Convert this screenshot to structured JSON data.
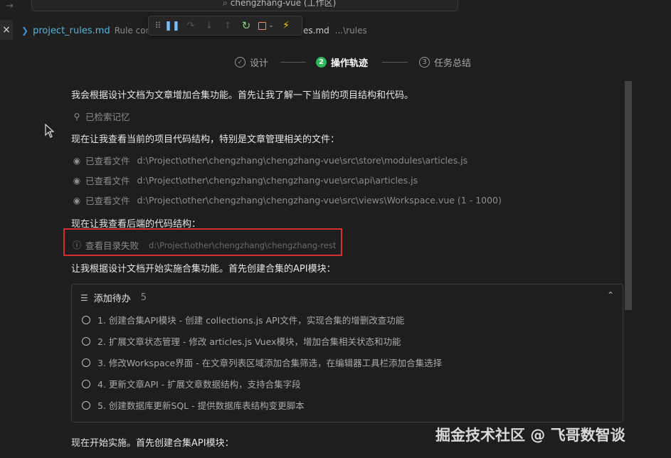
{
  "titlebar": {
    "forward_glyph": "→",
    "search_glyph": "⌕",
    "search_text": "chengzhang-vue (工作区)"
  },
  "tabs": {
    "close_glyph": "×",
    "active": {
      "icon": "❯",
      "name": "project_rules.md",
      "desc": "Rule confi"
    },
    "second": {
      "name": "es.md",
      "path": "...\\rules"
    }
  },
  "debug_toolbar": {
    "grip": "⠿",
    "pause": "❚❚",
    "step_over": "↷",
    "step_into": "↓",
    "step_out": "↑",
    "restart": "↻",
    "dropdown": "⌄",
    "bolt": "⚡"
  },
  "stepper": {
    "steps": [
      {
        "marker": "✓",
        "label": "设计"
      },
      {
        "marker": "2",
        "label": "操作轨迹"
      },
      {
        "marker": "3",
        "label": "任务总结"
      }
    ]
  },
  "messages": {
    "m1": "我会根据设计文档为文章增加合集功能。首先让我了解一下当前的项目结构和代码。",
    "m2": "现在让我查看当前的项目代码结构，特别是文章管理相关的文件：",
    "m3": "现在让我查看后端的代码结构：",
    "m4": "让我根据设计文档开始实施合集功能。首先创建合集的API模块：",
    "m5": "现在开始实施。首先创建合集API模块："
  },
  "actions": {
    "memory": {
      "icon": "⚲",
      "label": "已检索记忆"
    },
    "view1": {
      "icon": "◉",
      "label": "已查看文件",
      "path": "d:\\Project\\other\\chengzhang\\chengzhang-vue\\src\\store\\modules\\articles.js"
    },
    "view2": {
      "icon": "◉",
      "label": "已查看文件",
      "path": "d:\\Project\\other\\chengzhang\\chengzhang-vue\\src\\api\\articles.js"
    },
    "view3": {
      "icon": "◉",
      "label": "已查看文件",
      "path": "d:\\Project\\other\\chengzhang\\chengzhang-vue\\src\\views\\Workspace.vue (1 - 1000)"
    },
    "fail": {
      "icon": "ⓘ",
      "label": "查看目录失败",
      "path": "d:\\Project\\other\\chengzhang\\chengzhang-rest"
    }
  },
  "todo": {
    "icon": "☰",
    "title": "添加待办",
    "count": "5",
    "collapse_glyph": "⌃",
    "items": [
      "1. 创建合集API模块 - 创建 collections.js API文件，实现合集的增删改查功能",
      "2. 扩展文章状态管理 - 修改 articles.js Vuex模块，增加合集相关状态和功能",
      "3. 修改Workspace界面 - 在文章列表区域添加合集筛选，在编辑器工具栏添加合集选择",
      "4. 更新文章API - 扩展文章数据结构，支持合集字段",
      "5. 创建数据库更新SQL - 提供数据库表结构变更脚本"
    ]
  },
  "watermark": "掘金技术社区 @ 飞哥数智谈",
  "colors": {
    "background": "#1e1e1e",
    "accent_green": "#2fb85a",
    "highlight_red": "#d32f2f",
    "tab_blue": "#55b5db"
  }
}
